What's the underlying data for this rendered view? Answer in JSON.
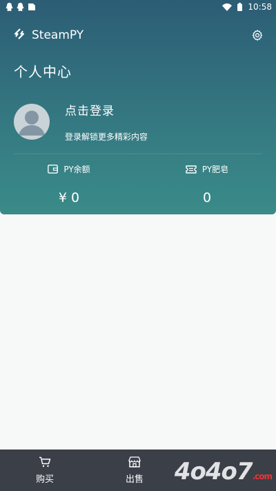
{
  "status_bar": {
    "time": "10:58",
    "icons": [
      "qq-icon",
      "qq-icon",
      "sim-icon",
      "wifi-icon",
      "battery-icon"
    ]
  },
  "app": {
    "name": "SteamPY"
  },
  "page": {
    "title": "个人中心"
  },
  "profile": {
    "login_label": "点击登录",
    "login_subtitle": "登录解锁更多精彩内容"
  },
  "stats": [
    {
      "icon": "wallet-icon",
      "label": "PY余额",
      "value": "¥ 0"
    },
    {
      "icon": "ticket-icon",
      "label": "PY肥皂",
      "value": "0"
    }
  ],
  "bottom_nav": [
    {
      "icon": "cart-icon",
      "label": "购买"
    },
    {
      "icon": "store-icon",
      "label": "出售"
    }
  ],
  "watermark": {
    "text": "4o4o7",
    "suffix": ".com"
  },
  "colors": {
    "header_top": "#2c5d75",
    "header_bottom": "#3a8b89",
    "nav_bg": "#3a3f48",
    "page_bg": "#f7f9f8"
  }
}
